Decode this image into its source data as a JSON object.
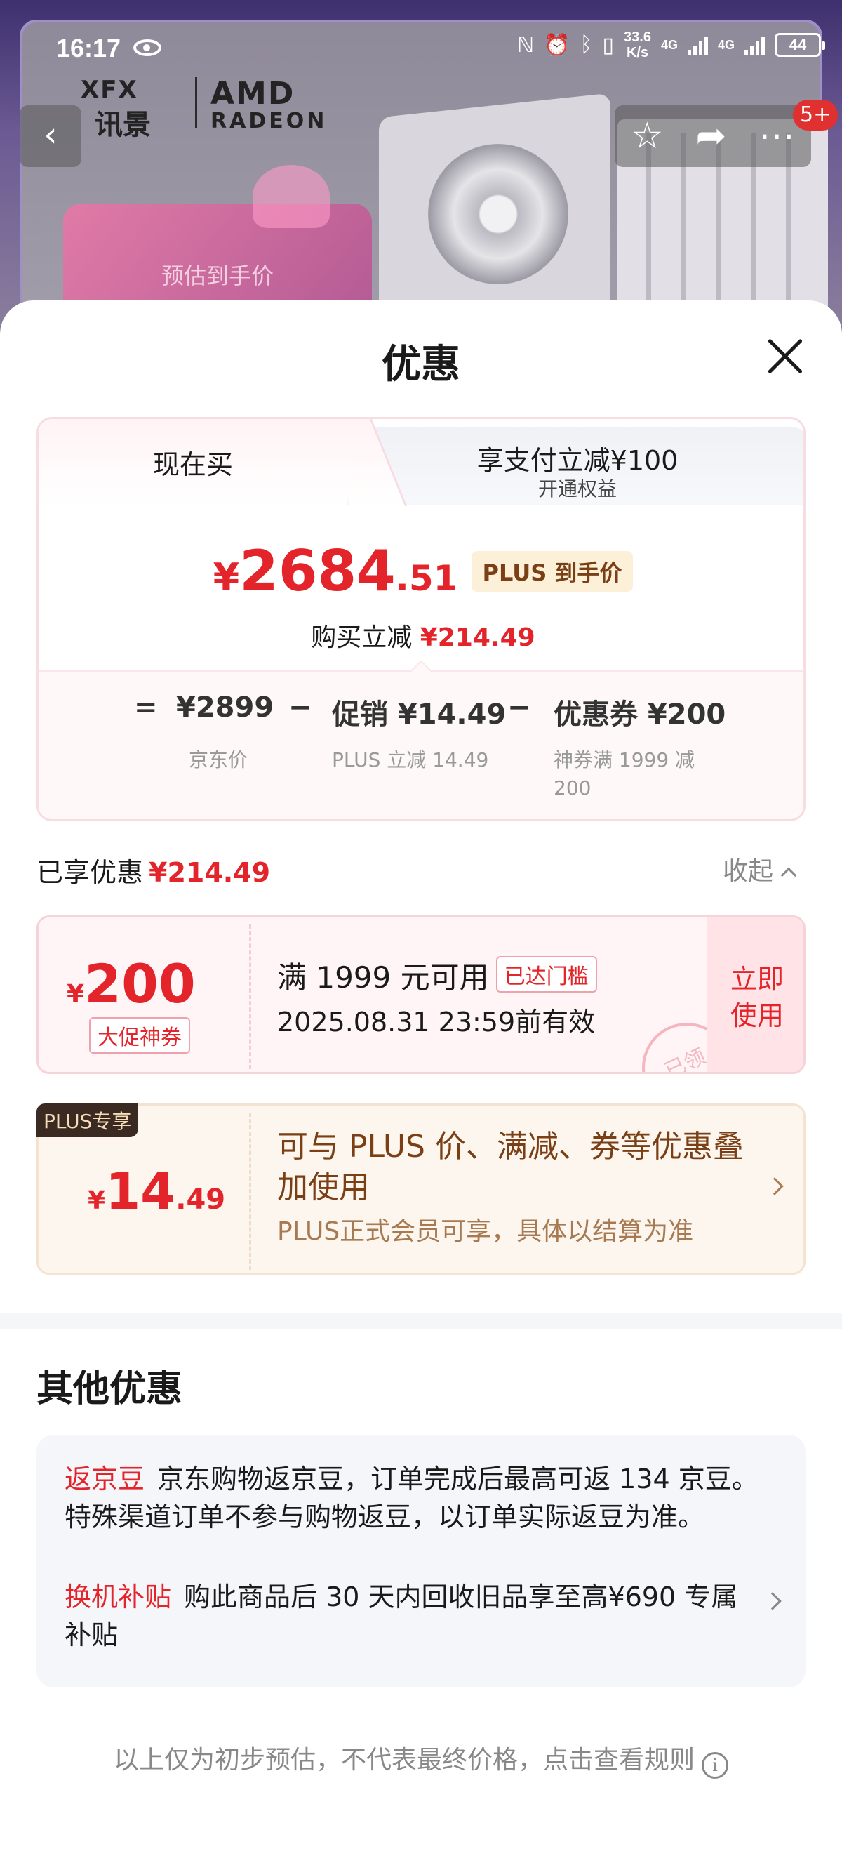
{
  "status_bar": {
    "time": "16:17",
    "net_speed_top": "33.6",
    "net_speed_bottom": "K/s",
    "sig1": "4G",
    "sig2": "4G",
    "battery": "44"
  },
  "brand": {
    "xfx": "XFX",
    "xfx_cn": "讯景",
    "amd": "AMD",
    "radeon": "RADEON"
  },
  "hero": {
    "promo_text": "预估到手价",
    "badge_count": "5+"
  },
  "sheet": {
    "title": "优惠",
    "tab_now": "现在买",
    "tab_other_line1": "享支付立减¥100",
    "tab_other_line2": "开通权益",
    "price_yen": "¥",
    "price_int": "2684",
    "price_dec": ".51",
    "plus_tag": "PLUS 到手价",
    "reduce_label": "购买立减",
    "reduce_amount": "¥214.49",
    "breakdown": {
      "eq": "=",
      "jd_price": "¥2899",
      "jd_price_label": "京东价",
      "minus1": "−",
      "promo": "促销 ¥14.49",
      "promo_label": "PLUS 立减 14.49",
      "minus2": "−",
      "coupon": "优惠券 ¥200",
      "coupon_label_1": "神券满 1999 减",
      "coupon_label_2": "200"
    },
    "enjoyed_label": "已享优惠",
    "enjoyed_amount": "¥214.49",
    "collapse_label": "收起",
    "coupon": {
      "yen": "¥",
      "amount": "200",
      "kind": "大促神券",
      "condition": "满 1999 元可用",
      "reached": "已达门槛",
      "validity": "2025.08.31 23:59前有效",
      "use_line1": "立即",
      "use_line2": "使用",
      "stamp": "已领"
    },
    "plus": {
      "badge": "PLUS专享",
      "yen": "¥",
      "int": "14",
      "dec": ".49",
      "line1": "可与 PLUS 价、满减、券等优惠叠加使用",
      "line3": "PLUS正式会员可享，具体以结算为准"
    },
    "other_title": "其他优惠",
    "other": [
      {
        "tag": "返京豆",
        "text": "京东购物返京豆，订单完成后最高可返 134 京豆。特殊渠道订单不参与购物返豆，以订单实际返豆为准。"
      },
      {
        "tag": "换机补贴",
        "text": "购此商品后 30 天内回收旧品享至高¥690 专属补贴"
      }
    ],
    "footer_note": "以上仅为初步预估，不代表最终价格，点击查看规则"
  }
}
